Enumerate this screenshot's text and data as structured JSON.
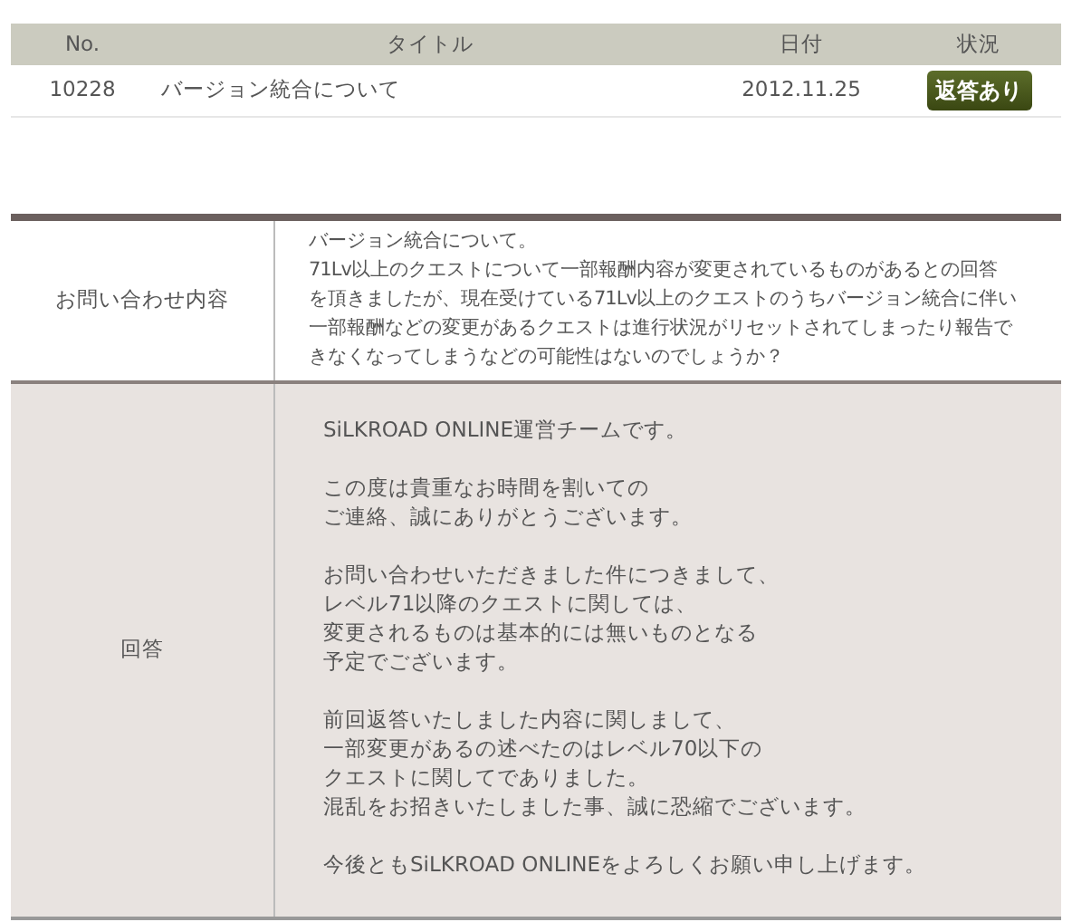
{
  "list_table": {
    "columns": [
      "No.",
      "タイトル",
      "日付",
      "状況"
    ],
    "rows": [
      {
        "no": "10228",
        "title": "バージョン統合について",
        "date": "2012.11.25",
        "status": "返答あり"
      }
    ]
  },
  "detail": [
    {
      "kind": "inquiry",
      "label": "お問い合わせ内容",
      "paragraphs": [
        [
          "バージョン統合について。",
          "71Lv以上のクエストについて一部報酬内容が変更されているものがあるとの回答",
          "を頂きましたが、現在受けている71Lv以上のクエストのうちバージョン統合に伴い",
          "一部報酬などの変更があるクエストは進行状況がリセットされてしまったり報告で",
          "きなくなってしまうなどの可能性はないのでしょうか？"
        ]
      ]
    },
    {
      "kind": "answer",
      "label": "回答",
      "paragraphs": [
        [
          "SiLKROAD ONLINE運営チームです。"
        ],
        [
          "この度は貴重なお時間を割いての",
          "ご連絡、誠にありがとうございます。"
        ],
        [
          "お問い合わせいただきました件につきまして、",
          "レベル71以降のクエストに関しては、",
          "変更されるものは基本的には無いものとなる",
          "予定でございます。"
        ],
        [
          "前回返答いたしました内容に関しまして、",
          "一部変更があるの述べたのはレベル70以下の",
          "クエストに関してでありました。",
          "混乱をお招きいたしました事、誠に恐縮でございます。"
        ],
        [
          "今後ともSiLKROAD ONLINEをよろしくお願い申し上げます。"
        ]
      ]
    }
  ]
}
